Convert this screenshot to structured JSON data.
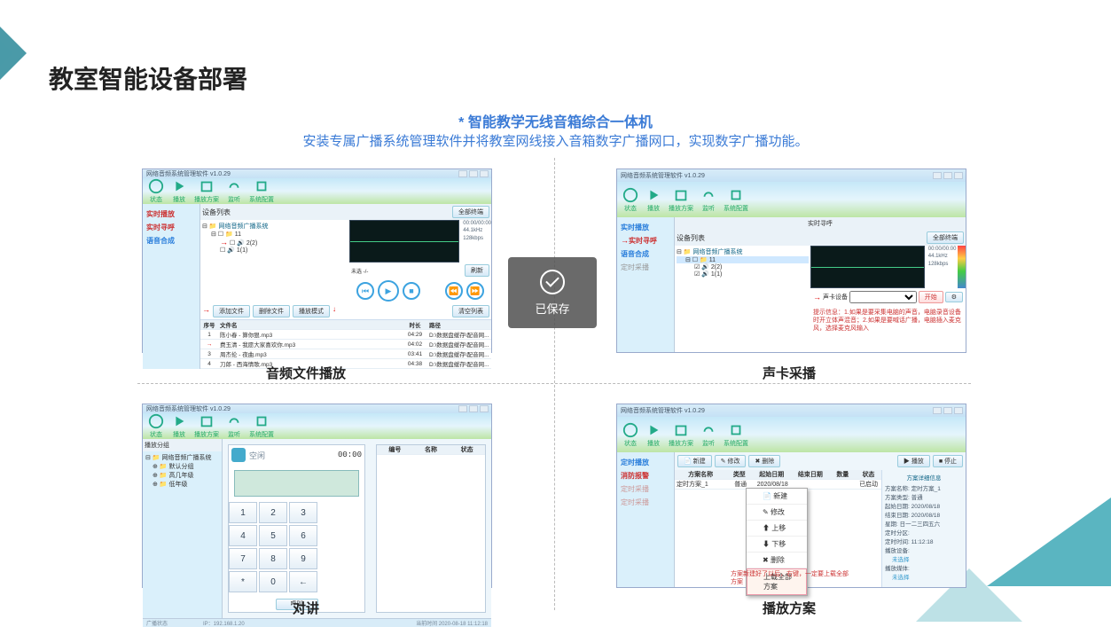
{
  "page": {
    "title": "教室智能设备部署",
    "subtitle": "* 智能教学无线音箱综合一体机",
    "desc": "安装专属广播系统管理软件并将教室网线接入音箱数字广播网口，实现数字广播功能。"
  },
  "toast": "已保存",
  "captions": {
    "p1": "音频文件播放",
    "p2": "声卡采播",
    "p3": "对讲",
    "p4": "播放方案"
  },
  "app": {
    "titlebar": "网络音频系统管理软件 v1.0.29",
    "tools": [
      "状态",
      "播放",
      "播放方案",
      "监听",
      "系统配置"
    ],
    "side": {
      "a": "实时播放",
      "b": "实时寻呼",
      "c": "语音合成",
      "d": "定时播放",
      "e": "消防报警"
    },
    "tree": {
      "root": "网络音频广播系统",
      "n1": "11",
      "n2": "2(2)",
      "n3": "1(1)"
    },
    "listhdr": "设备列表",
    "allbtn": "全部终端",
    "wave": {
      "t1": "00:00/00:00",
      "t2": "44.1kHz",
      "t3": "128kbps",
      "mode": "未选 -/-"
    },
    "btns": {
      "add": "添加文件",
      "del": "删除文件",
      "mode": "播放模式",
      "clear": "清空列表"
    },
    "thdr": {
      "c1": "序号",
      "c2": "文件名",
      "c3": "时长",
      "c4": "路径"
    },
    "rows": [
      {
        "n": "1",
        "f": "陈小春 - 算你狠.mp3",
        "d": "04:29",
        "p": "D:\\数据盘缓存\\配音网..."
      },
      {
        "n": "2",
        "f": "费玉清 - 我愿大家喜欢你.mp3",
        "d": "04:02",
        "p": "D:\\数据盘缓存\\配音网..."
      },
      {
        "n": "3",
        "f": "周杰伦 - 夜曲.mp3",
        "d": "03:41",
        "p": "D:\\数据盘缓存\\配音网..."
      },
      {
        "n": "4",
        "f": "刀郎 - 西海情歌.mp3",
        "d": "04:38",
        "p": "D:\\数据盘缓存\\配音网..."
      }
    ],
    "capture": {
      "label": "声卡设备",
      "start": "开始",
      "note": "提示信息：1.如果是要采集电脑的声音，电脑录音设备时开立体声混音；2.如果是要喊话广播，电脑插入麦克风，选择麦克风输入"
    },
    "refresh": "刷新",
    "dialpad": {
      "idle": "空闲",
      "time": "00:00",
      "call": "呼叫",
      "hdr_num": "编号",
      "hdr_name": "名称",
      "hdr_stat": "状态"
    },
    "plan": {
      "btn_new": "新建",
      "btn_edit": "修改",
      "btn_del": "删除",
      "btn_play": "播放",
      "btn_stop": "停止",
      "cols": {
        "c1": "方案名称",
        "c2": "类型",
        "c3": "起始日期",
        "c4": "结束日期",
        "c5": "数量",
        "c6": "状态"
      },
      "row": {
        "c1": "定时方案_1",
        "c2": "普通",
        "c3": "2020/08/18",
        "c4": "",
        "c5": "",
        "c6": "已启动"
      },
      "ctx": [
        "新建",
        "修改",
        "上移",
        "下移",
        "删除",
        "上载全部方案"
      ],
      "note": "方案新建好了以后，右键，一定要上载全部方案",
      "info_title": "方案详细信息",
      "info": [
        "方案名称: 定时方案_1",
        "方案类型: 普通",
        "起始日期: 2020/08/18",
        "结束日期: 2020/08/18",
        "星期: 日一二三四五六",
        "定时分区:",
        "定时时间: 11:12:18",
        "播放设备:",
        "未选择",
        "播放媒体:",
        "未选择"
      ]
    }
  }
}
